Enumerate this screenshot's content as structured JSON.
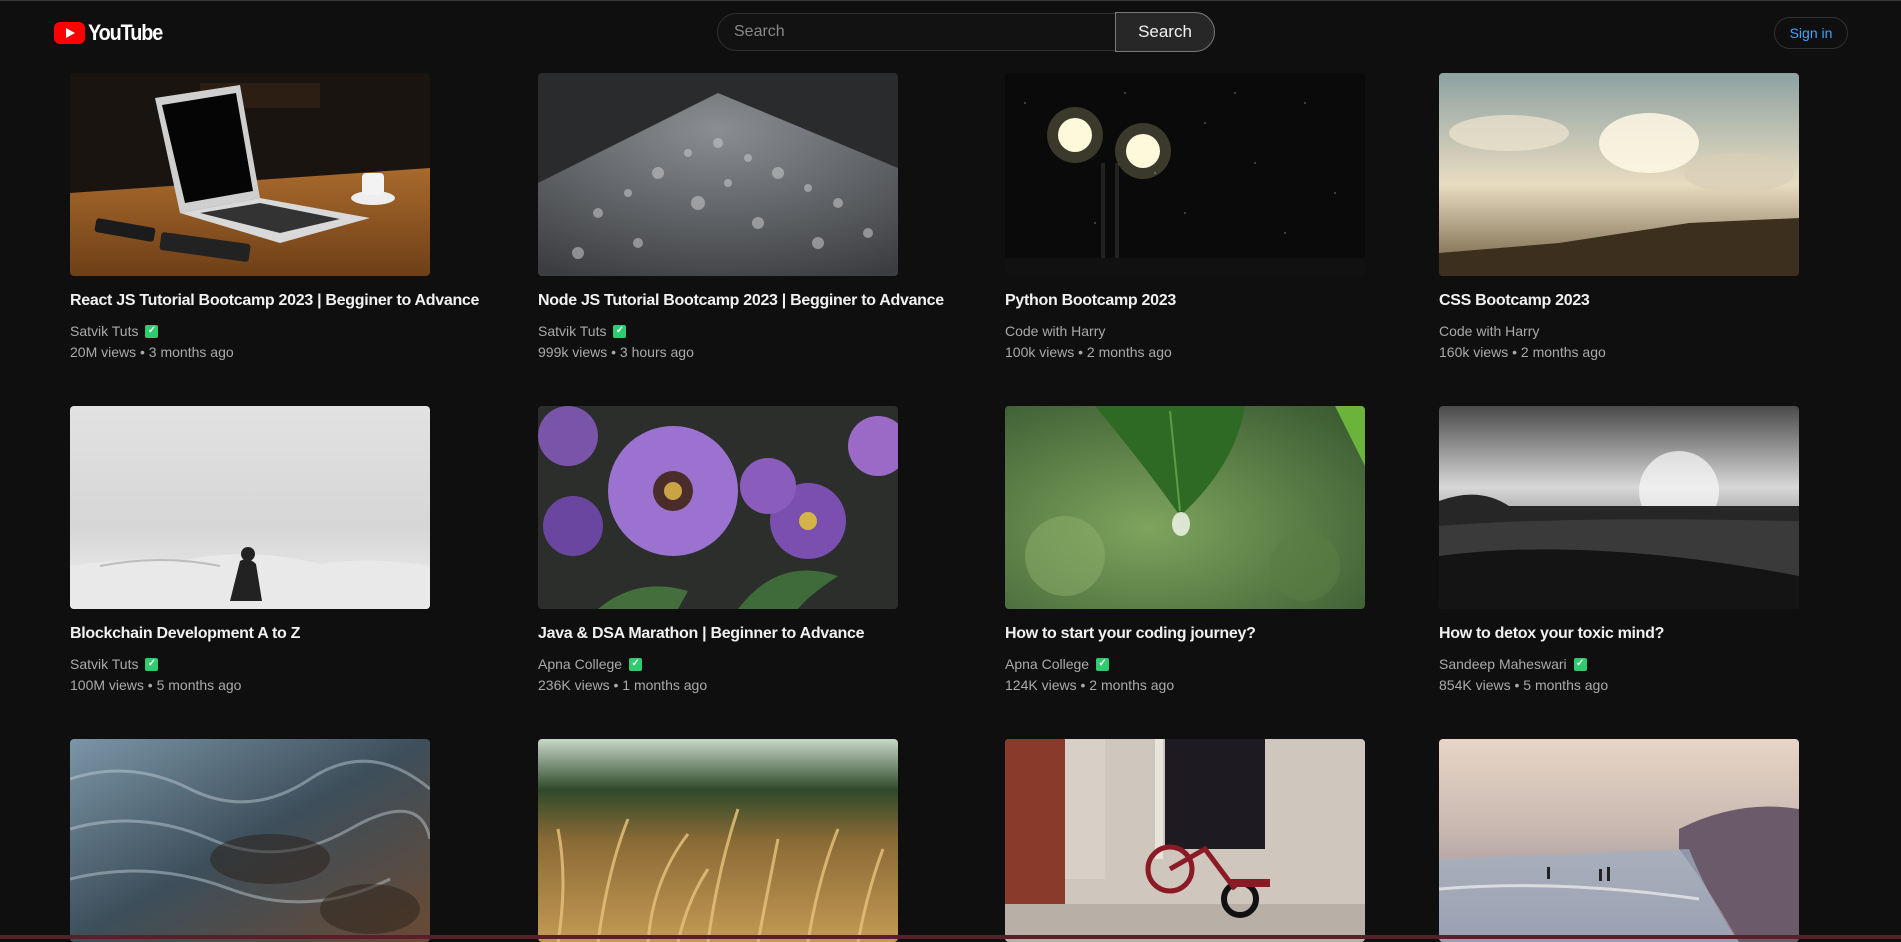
{
  "header": {
    "logo_text": "YouTube",
    "search_placeholder": "Search",
    "search_button": "Search",
    "signin_label": "Sign in"
  },
  "videos": [
    {
      "title": "React JS Tutorial Bootcamp 2023 | Begginer to Advance",
      "channel": "Satvik Tuts",
      "verified": true,
      "meta": "20M views • 3 months ago",
      "thumb": "laptop"
    },
    {
      "title": "Node JS Tutorial Bootcamp 2023 | Begginer to Advance",
      "channel": "Satvik Tuts",
      "verified": true,
      "meta": "999k views • 3 hours ago",
      "thumb": "droplets"
    },
    {
      "title": "Python Bootcamp 2023",
      "channel": "Code with Harry",
      "verified": false,
      "meta": "100k views • 2 months ago",
      "thumb": "lamps"
    },
    {
      "title": "CSS Bootcamp 2023",
      "channel": "Code with Harry",
      "verified": false,
      "meta": "160k views • 2 months ago",
      "thumb": "clouds"
    },
    {
      "title": "Blockchain Development A to Z",
      "channel": "Satvik Tuts",
      "verified": true,
      "meta": "100M views • 5 months ago",
      "thumb": "desert"
    },
    {
      "title": "Java & DSA Marathon | Beginner to Advance",
      "channel": "Apna College",
      "verified": true,
      "meta": "236K views • 1 months ago",
      "thumb": "flowers"
    },
    {
      "title": "How to start your coding journey?",
      "channel": "Apna College",
      "verified": true,
      "meta": "124K views • 2 months ago",
      "thumb": "leaf"
    },
    {
      "title": "How to detox your toxic mind?",
      "channel": "Sandeep Maheswari",
      "verified": true,
      "meta": "854K views • 5 months ago",
      "thumb": "landscape"
    },
    {
      "title": "",
      "channel": "",
      "verified": false,
      "meta": "",
      "thumb": "water"
    },
    {
      "title": "",
      "channel": "",
      "verified": false,
      "meta": "",
      "thumb": "wheat"
    },
    {
      "title": "",
      "channel": "",
      "verified": false,
      "meta": "",
      "thumb": "tricycle"
    },
    {
      "title": "",
      "channel": "",
      "verified": false,
      "meta": "",
      "thumb": "beach"
    }
  ]
}
